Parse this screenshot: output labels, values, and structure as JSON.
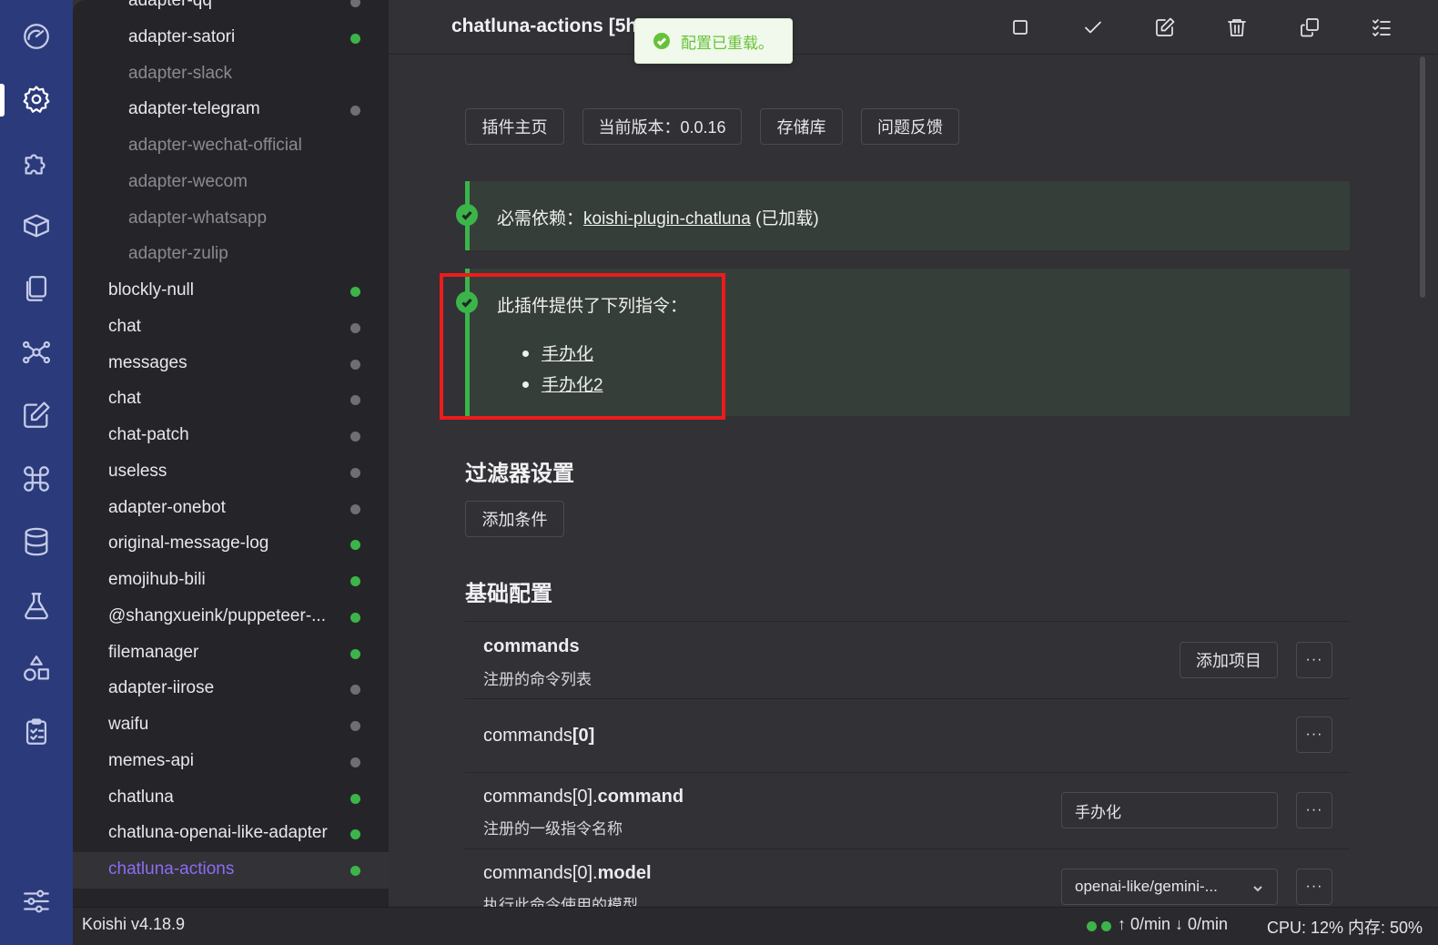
{
  "activity_bar": {
    "icons": [
      "dashboard-icon",
      "settings-icon",
      "plugin-icon",
      "market-icon",
      "files-icon",
      "graph-icon",
      "edit-icon",
      "command-icon",
      "database-icon",
      "sandbox-icon",
      "shapes-icon",
      "logs-icon",
      "preferences-icon"
    ],
    "active": "settings-icon"
  },
  "sidebar": {
    "items": [
      {
        "label": "adapter-qq",
        "status": "gray",
        "nested": true,
        "disabled": false
      },
      {
        "label": "adapter-satori",
        "status": "green",
        "nested": true,
        "disabled": false
      },
      {
        "label": "adapter-slack",
        "status": "",
        "nested": true,
        "disabled": true
      },
      {
        "label": "adapter-telegram",
        "status": "gray",
        "nested": true,
        "disabled": false
      },
      {
        "label": "adapter-wechat-official",
        "status": "",
        "nested": true,
        "disabled": true
      },
      {
        "label": "adapter-wecom",
        "status": "",
        "nested": true,
        "disabled": true
      },
      {
        "label": "adapter-whatsapp",
        "status": "",
        "nested": true,
        "disabled": true
      },
      {
        "label": "adapter-zulip",
        "status": "",
        "nested": true,
        "disabled": true
      },
      {
        "label": "blockly-null",
        "status": "green",
        "nested": false,
        "disabled": false
      },
      {
        "label": "chat",
        "status": "gray",
        "nested": false,
        "disabled": false
      },
      {
        "label": "messages",
        "status": "gray",
        "nested": false,
        "disabled": false
      },
      {
        "label": "chat",
        "status": "gray",
        "nested": false,
        "disabled": false
      },
      {
        "label": "chat-patch",
        "status": "gray",
        "nested": false,
        "disabled": false
      },
      {
        "label": "useless",
        "status": "gray",
        "nested": false,
        "disabled": false
      },
      {
        "label": "adapter-onebot",
        "status": "gray",
        "nested": false,
        "disabled": false
      },
      {
        "label": "original-message-log",
        "status": "green",
        "nested": false,
        "disabled": false
      },
      {
        "label": "emojihub-bili",
        "status": "green",
        "nested": false,
        "disabled": false
      },
      {
        "label": "@shangxueink/puppeteer-...",
        "status": "green",
        "nested": false,
        "disabled": false
      },
      {
        "label": "filemanager",
        "status": "green",
        "nested": false,
        "disabled": false
      },
      {
        "label": "adapter-iirose",
        "status": "gray",
        "nested": false,
        "disabled": false
      },
      {
        "label": "waifu",
        "status": "gray",
        "nested": false,
        "disabled": false
      },
      {
        "label": "memes-api",
        "status": "gray",
        "nested": false,
        "disabled": false
      },
      {
        "label": "chatluna",
        "status": "green",
        "nested": false,
        "disabled": false
      },
      {
        "label": "chatluna-openai-like-adapter",
        "status": "green",
        "nested": false,
        "disabled": false
      },
      {
        "label": "chatluna-actions",
        "status": "green",
        "nested": false,
        "disabled": false,
        "selected": true
      }
    ]
  },
  "header": {
    "title": "chatluna-actions [5h",
    "toolbar": [
      "stop-icon",
      "check-icon",
      "rename-icon",
      "delete-icon",
      "copy-icon",
      "checklist-icon"
    ]
  },
  "toast": {
    "message": "配置已重载。"
  },
  "links": {
    "homepage": "插件主页",
    "version": "当前版本：0.0.16",
    "repository": "存储库",
    "feedback": "问题反馈"
  },
  "dependency_notice": {
    "prefix": "必需依赖：",
    "plugin": "koishi-plugin-chatluna",
    "suffix": " (已加载)"
  },
  "commands_notice": {
    "text": "此插件提供了下列指令：",
    "commands": [
      "手办化",
      "手办化2"
    ]
  },
  "filter_section": {
    "title": "过滤器设置",
    "add_condition": "添加条件"
  },
  "basic_section": {
    "title": "基础配置",
    "rows": [
      {
        "name_prefix": "",
        "name_bold": "commands",
        "desc": "注册的命令列表",
        "action": "添加项目"
      },
      {
        "name_prefix": "commands",
        "name_bold": "[0]",
        "desc": ""
      },
      {
        "name_prefix": "commands[0].",
        "name_bold": "command",
        "desc": "注册的一级指令名称",
        "value": "手办化"
      },
      {
        "name_prefix": "commands[0].",
        "name_bold": "model",
        "desc": "执行此命令使用的模型",
        "value": "openai-like/gemini-..."
      }
    ],
    "more_label": "···"
  },
  "statusbar": {
    "version": "Koishi v4.18.9",
    "rates": "↑ 0/min ↓ 0/min",
    "usage": "CPU: 12% 内存: 50%"
  },
  "colors": {
    "accent": "#8d6cf3",
    "success": "#3bb54a",
    "highlight": "#ee1b1b",
    "activity_bar": "#2b3a7a"
  }
}
